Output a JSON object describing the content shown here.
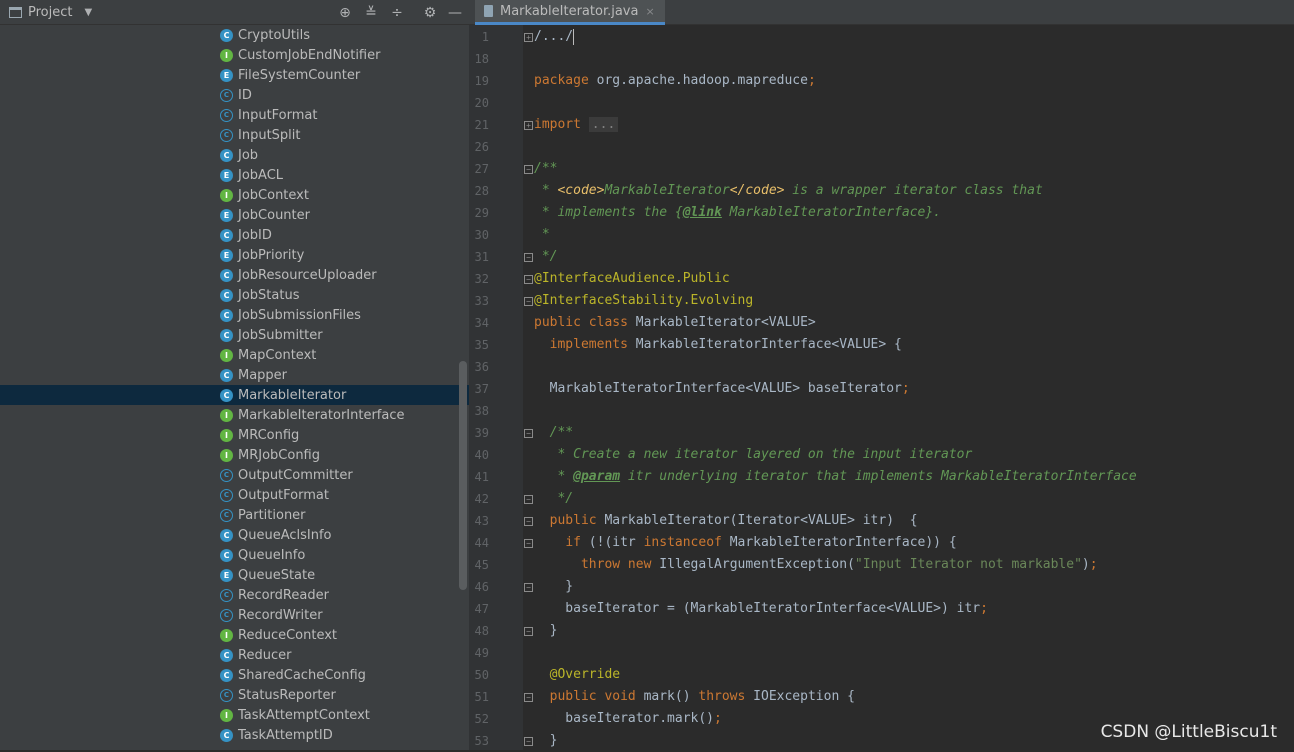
{
  "project_panel": {
    "title": "Project",
    "tools": [
      "locate-icon",
      "expand-all-icon",
      "collapse-all-icon",
      "gear-icon",
      "hide-icon"
    ],
    "items": [
      {
        "label": "CryptoUtils",
        "kind": "C"
      },
      {
        "label": "CustomJobEndNotifier",
        "kind": "I"
      },
      {
        "label": "FileSystemCounter",
        "kind": "E"
      },
      {
        "label": "ID",
        "kind": "A"
      },
      {
        "label": "InputFormat",
        "kind": "A"
      },
      {
        "label": "InputSplit",
        "kind": "A"
      },
      {
        "label": "Job",
        "kind": "C"
      },
      {
        "label": "JobACL",
        "kind": "E"
      },
      {
        "label": "JobContext",
        "kind": "I"
      },
      {
        "label": "JobCounter",
        "kind": "E"
      },
      {
        "label": "JobID",
        "kind": "C"
      },
      {
        "label": "JobPriority",
        "kind": "E"
      },
      {
        "label": "JobResourceUploader",
        "kind": "C"
      },
      {
        "label": "JobStatus",
        "kind": "C"
      },
      {
        "label": "JobSubmissionFiles",
        "kind": "C"
      },
      {
        "label": "JobSubmitter",
        "kind": "C"
      },
      {
        "label": "MapContext",
        "kind": "I"
      },
      {
        "label": "Mapper",
        "kind": "C"
      },
      {
        "label": "MarkableIterator",
        "kind": "C"
      },
      {
        "label": "MarkableIteratorInterface",
        "kind": "I"
      },
      {
        "label": "MRConfig",
        "kind": "I"
      },
      {
        "label": "MRJobConfig",
        "kind": "I"
      },
      {
        "label": "OutputCommitter",
        "kind": "A"
      },
      {
        "label": "OutputFormat",
        "kind": "A"
      },
      {
        "label": "Partitioner",
        "kind": "A"
      },
      {
        "label": "QueueAclsInfo",
        "kind": "C"
      },
      {
        "label": "QueueInfo",
        "kind": "C"
      },
      {
        "label": "QueueState",
        "kind": "E"
      },
      {
        "label": "RecordReader",
        "kind": "A"
      },
      {
        "label": "RecordWriter",
        "kind": "A"
      },
      {
        "label": "ReduceContext",
        "kind": "I"
      },
      {
        "label": "Reducer",
        "kind": "C"
      },
      {
        "label": "SharedCacheConfig",
        "kind": "C"
      },
      {
        "label": "StatusReporter",
        "kind": "A"
      },
      {
        "label": "TaskAttemptContext",
        "kind": "I"
      },
      {
        "label": "TaskAttemptID",
        "kind": "C"
      }
    ],
    "selected_item": "MarkableIterator"
  },
  "editor": {
    "tab_label": "MarkableIterator.java",
    "tab_close": "×",
    "lines": [
      {
        "n": "1",
        "segs": [
          [
            "p",
            "/.../"
          ]
        ],
        "fold": "+",
        "caret": true
      },
      {
        "n": "18",
        "segs": []
      },
      {
        "n": "19",
        "segs": [
          [
            "kw",
            "package "
          ],
          [
            "p",
            "org.apache.hadoop.mapreduce"
          ],
          [
            "kw",
            ";"
          ]
        ]
      },
      {
        "n": "20",
        "segs": []
      },
      {
        "n": "21",
        "segs": [
          [
            "kw",
            "import "
          ],
          [
            "fold",
            "..."
          ]
        ],
        "fold": "+"
      },
      {
        "n": "26",
        "segs": []
      },
      {
        "n": "27",
        "segs": [
          [
            "cm",
            "/**"
          ]
        ],
        "fold": "-"
      },
      {
        "n": "28",
        "segs": [
          [
            "cm",
            " * "
          ],
          [
            "tag",
            "<code>"
          ],
          [
            "cm",
            "MarkableIterator"
          ],
          [
            "tag",
            "</code>"
          ],
          [
            "cm",
            " is a wrapper iterator class that"
          ]
        ]
      },
      {
        "n": "29",
        "segs": [
          [
            "cm",
            " * implements the {"
          ],
          [
            "tagb",
            "@link"
          ],
          [
            "cm",
            " MarkableIteratorInterface}."
          ]
        ]
      },
      {
        "n": "30",
        "segs": [
          [
            "cm",
            " *"
          ]
        ]
      },
      {
        "n": "31",
        "segs": [
          [
            "cm",
            " */"
          ]
        ],
        "fold": "-"
      },
      {
        "n": "32",
        "segs": [
          [
            "ann",
            "@InterfaceAudience.Public"
          ]
        ],
        "fold": "-"
      },
      {
        "n": "33",
        "segs": [
          [
            "ann",
            "@InterfaceStability.Evolving"
          ]
        ],
        "fold": "-"
      },
      {
        "n": "34",
        "segs": [
          [
            "kw",
            "public class "
          ],
          [
            "p",
            "MarkableIterator<VALUE>"
          ]
        ]
      },
      {
        "n": "35",
        "segs": [
          [
            "p",
            "  "
          ],
          [
            "kw",
            "implements "
          ],
          [
            "p",
            "MarkableIteratorInterface<VALUE> {"
          ]
        ]
      },
      {
        "n": "36",
        "segs": []
      },
      {
        "n": "37",
        "segs": [
          [
            "p",
            "  MarkableIteratorInterface<VALUE> baseIterator"
          ],
          [
            "kw",
            ";"
          ]
        ]
      },
      {
        "n": "38",
        "segs": []
      },
      {
        "n": "39",
        "segs": [
          [
            "cm",
            "  /**"
          ]
        ],
        "fold": "-"
      },
      {
        "n": "40",
        "segs": [
          [
            "cm",
            "   * Create a new iterator layered on the input iterator"
          ]
        ]
      },
      {
        "n": "41",
        "segs": [
          [
            "cm",
            "   * "
          ],
          [
            "tagb",
            "@param"
          ],
          [
            "cm",
            " itr underlying iterator that implements MarkableIteratorInterface"
          ]
        ]
      },
      {
        "n": "42",
        "segs": [
          [
            "cm",
            "   */"
          ]
        ],
        "fold": "-"
      },
      {
        "n": "43",
        "segs": [
          [
            "p",
            "  "
          ],
          [
            "kw",
            "public "
          ],
          [
            "p",
            "MarkableIterator(Iterator<VALUE> itr)  {"
          ]
        ],
        "fold": "-"
      },
      {
        "n": "44",
        "segs": [
          [
            "p",
            "    "
          ],
          [
            "kw",
            "if "
          ],
          [
            "p",
            "(!(itr "
          ],
          [
            "kw",
            "instanceof "
          ],
          [
            "p",
            "MarkableIteratorInterface)) {"
          ]
        ],
        "fold": "-"
      },
      {
        "n": "45",
        "segs": [
          [
            "p",
            "      "
          ],
          [
            "kw",
            "throw new "
          ],
          [
            "p",
            "IllegalArgumentException("
          ],
          [
            "str",
            "\"Input Iterator not markable\""
          ],
          [
            "p",
            ")"
          ],
          [
            "kw",
            ";"
          ]
        ]
      },
      {
        "n": "46",
        "segs": [
          [
            "p",
            "    }"
          ]
        ],
        "fold": "-"
      },
      {
        "n": "47",
        "segs": [
          [
            "p",
            "    baseIterator = (MarkableIteratorInterface<VALUE>) itr"
          ],
          [
            "kw",
            ";"
          ]
        ]
      },
      {
        "n": "48",
        "segs": [
          [
            "p",
            "  }"
          ]
        ],
        "fold": "-"
      },
      {
        "n": "49",
        "segs": []
      },
      {
        "n": "50",
        "segs": [
          [
            "ann",
            "  @Override"
          ]
        ]
      },
      {
        "n": "51",
        "segs": [
          [
            "p",
            "  "
          ],
          [
            "kw",
            "public void "
          ],
          [
            "p",
            "mark() "
          ],
          [
            "kw",
            "throws "
          ],
          [
            "p",
            "IOException {"
          ]
        ],
        "fold": "-"
      },
      {
        "n": "52",
        "segs": [
          [
            "p",
            "    baseIterator.mark()"
          ],
          [
            "kw",
            ";"
          ]
        ]
      },
      {
        "n": "53",
        "segs": [
          [
            "p",
            "  }"
          ]
        ],
        "fold": "-"
      }
    ]
  },
  "watermark": "CSDN @LittleBiscu1t"
}
